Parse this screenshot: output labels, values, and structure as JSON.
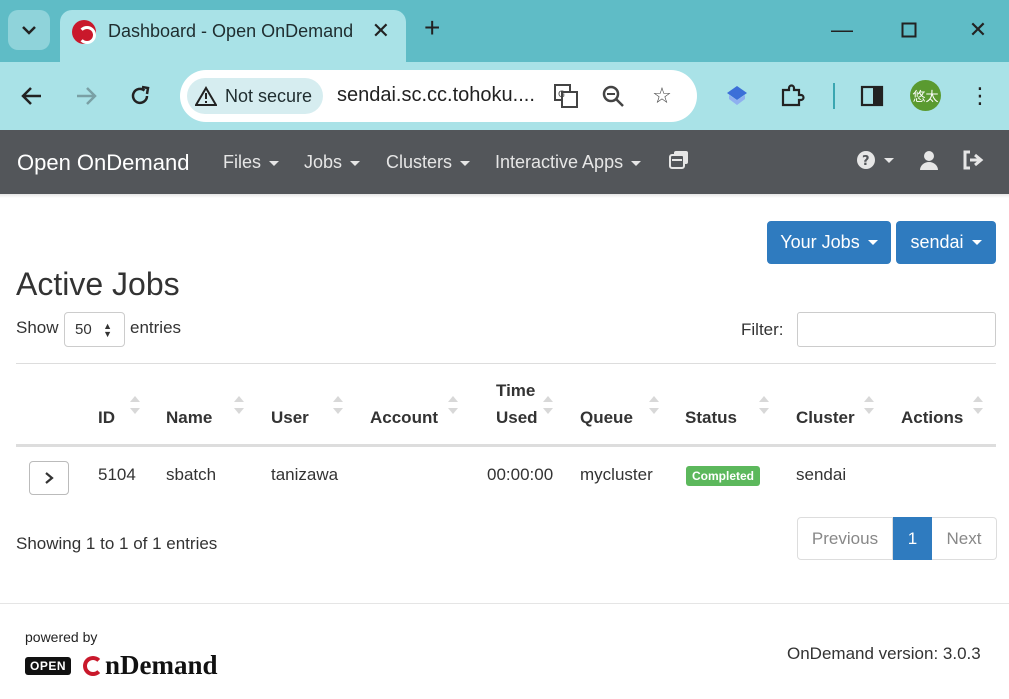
{
  "browser": {
    "tab_title": "Dashboard - Open OnDemand",
    "security_label": "Not secure",
    "url": "sendai.sc.cc.tohoku....",
    "profile_initials": "悠太",
    "colors": {
      "tabstrip": "#5fbcc6",
      "toolbar": "#a9e2e7"
    }
  },
  "navbar": {
    "brand": "Open OnDemand",
    "items": [
      {
        "label": "Files"
      },
      {
        "label": "Jobs"
      },
      {
        "label": "Clusters"
      },
      {
        "label": "Interactive Apps"
      }
    ],
    "icons": [
      "sessions-icon",
      "help-icon",
      "user-icon",
      "logout-icon"
    ],
    "color": "#53565a"
  },
  "content": {
    "your_jobs_button": "Your Jobs",
    "cluster_button": "sendai",
    "title": "Active Jobs",
    "show_label": "Show",
    "page_length": "50",
    "entries_label": "entries",
    "filter_label": "Filter:",
    "filter_value": ""
  },
  "table": {
    "headers": {
      "id": "ID",
      "name": "Name",
      "user": "User",
      "account": "Account",
      "time_used_1": "Time",
      "time_used_2": "Used",
      "queue": "Queue",
      "status": "Status",
      "cluster": "Cluster",
      "actions": "Actions"
    },
    "rows": [
      {
        "id": "5104",
        "name": "sbatch",
        "user": "tanizawa",
        "account": "",
        "time_used": "00:00:00",
        "queue": "mycluster",
        "status": "Completed",
        "cluster": "sendai",
        "actions": ""
      }
    ],
    "status_color": "#5cb85c"
  },
  "pagination": {
    "info": "Showing 1 to 1 of 1 entries",
    "previous": "Previous",
    "current": "1",
    "next": "Next"
  },
  "footer": {
    "powered_by": "powered by",
    "logo_open": "OPEN",
    "logo_text": "nDemand",
    "version": "OnDemand version: 3.0.3"
  }
}
